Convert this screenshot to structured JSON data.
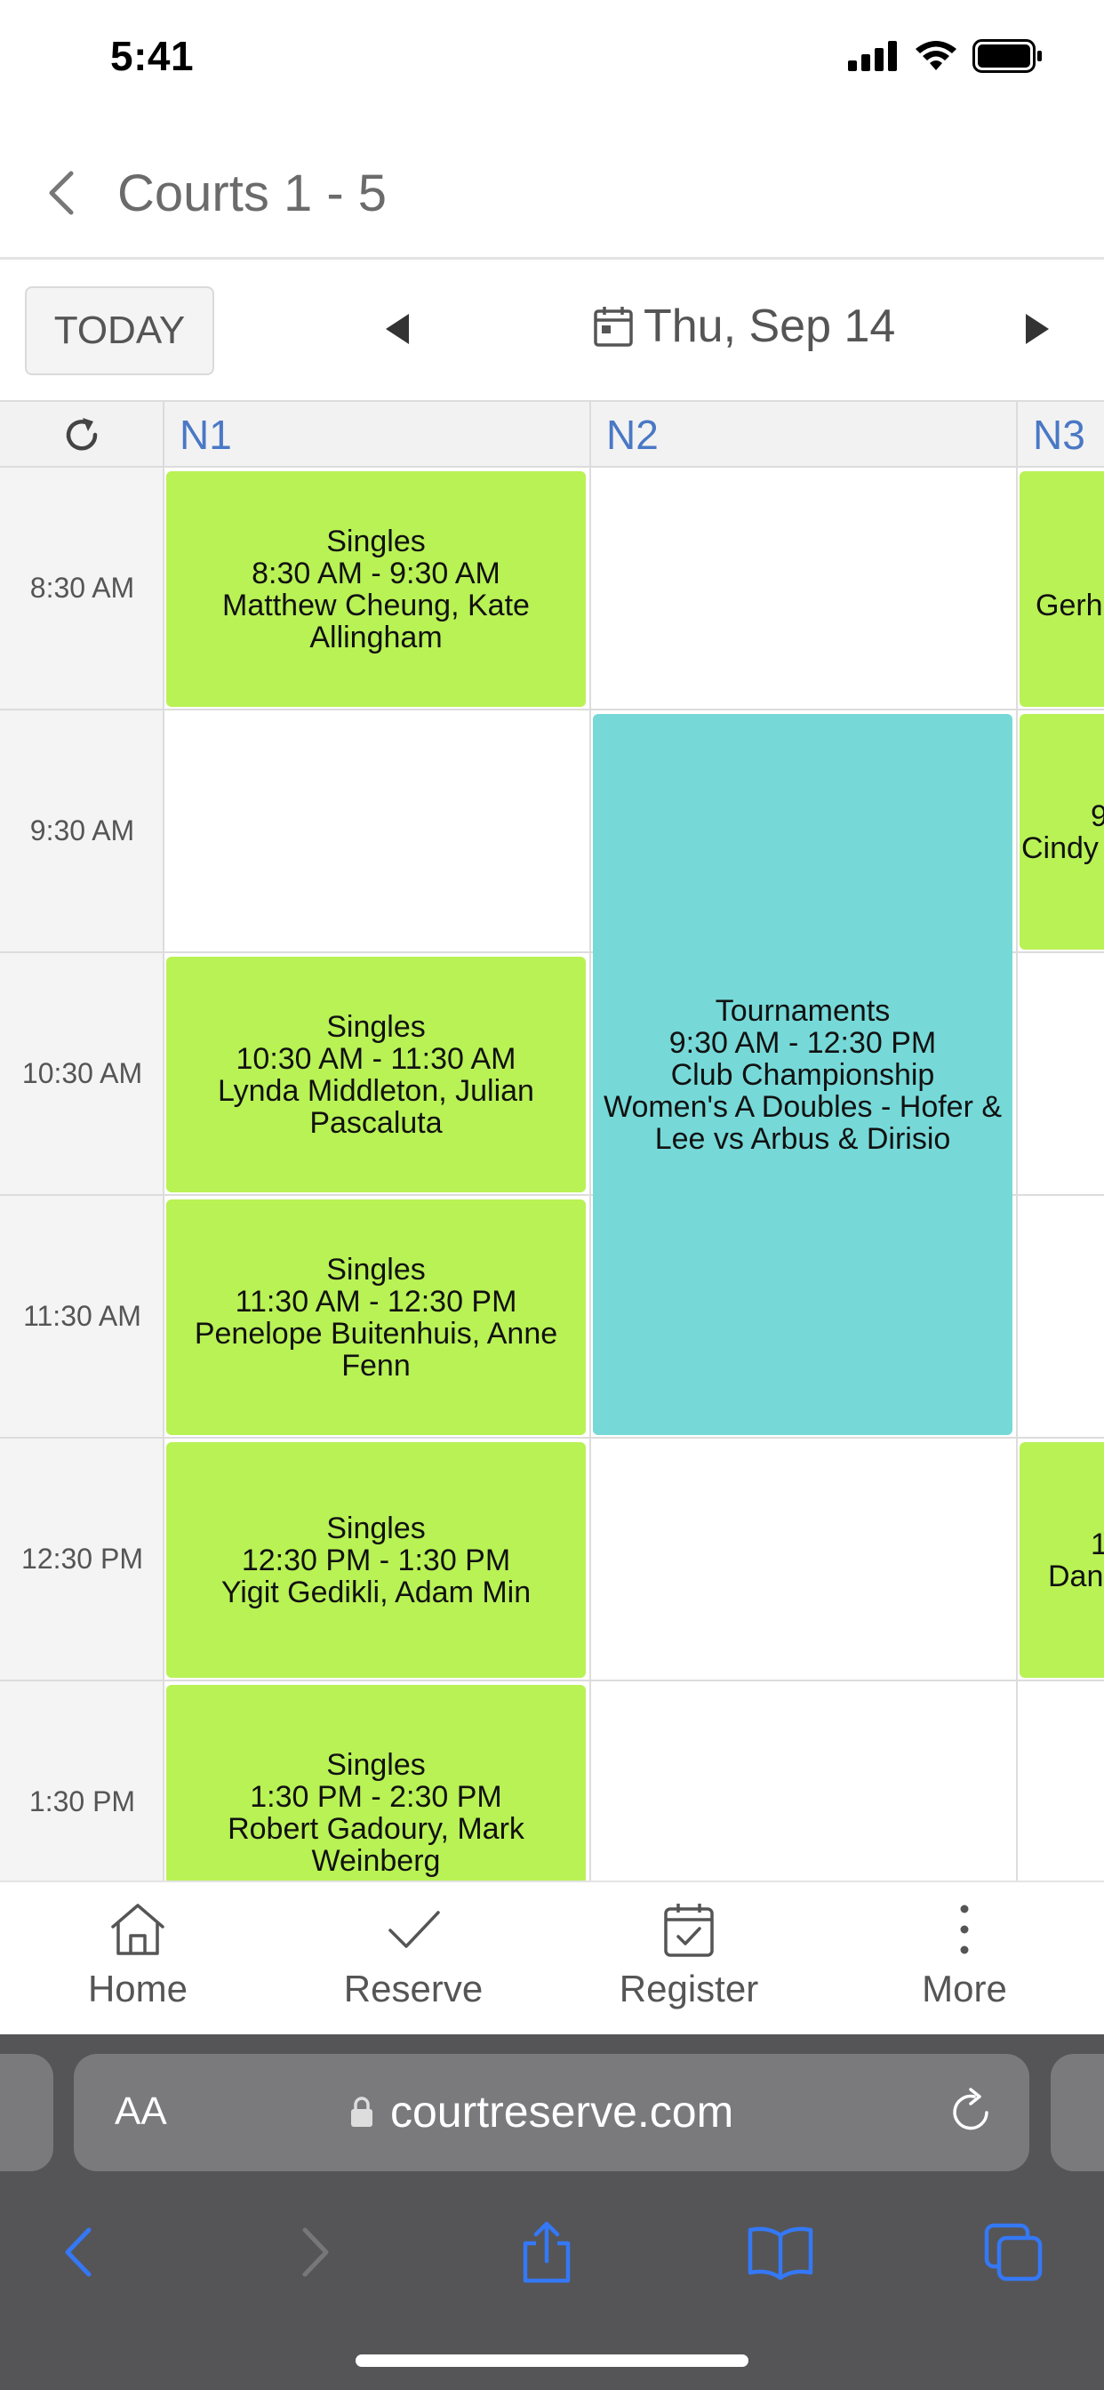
{
  "status_bar": {
    "time": "5:41"
  },
  "header": {
    "title": "Courts 1 - 5"
  },
  "toolbar": {
    "today_label": "TODAY",
    "date": "Thu, Sep 14"
  },
  "scheduler": {
    "courts": [
      "N1",
      "N2",
      "N3"
    ],
    "times": [
      "8:30 AM",
      "9:30 AM",
      "10:30 AM",
      "11:30 AM",
      "12:30 PM",
      "1:30 PM"
    ],
    "events": [
      {
        "court": "N1",
        "type": "Singles",
        "time": "8:30 AM - 9:30 AM",
        "players": "Matthew Cheung, Kate Allingham"
      },
      {
        "court": "N1",
        "type": "Singles",
        "time": "10:30 AM - 11:30 AM",
        "players": "Lynda Middleton, Julian Pascaluta"
      },
      {
        "court": "N1",
        "type": "Singles",
        "time": "11:30 AM - 12:30 PM",
        "players": "Penelope Buitenhuis, Anne Fenn"
      },
      {
        "court": "N1",
        "type": "Singles",
        "time": "12:30 PM - 1:30 PM",
        "players": "Yigit Gedikli, Adam Min"
      },
      {
        "court": "N1",
        "type": "Singles",
        "time": "1:30 PM - 2:30 PM",
        "players": "Robert Gadoury, Mark Weinberg"
      },
      {
        "court": "N2",
        "type": "Tournaments",
        "time": "9:30 AM - 12:30 PM",
        "title": "Club Championship",
        "detail": "Women's A Doubles - Hofer & Lee vs Arbus & Dirisio"
      },
      {
        "court": "N3",
        "partial_line1": "8",
        "partial_line2": "Gerh"
      },
      {
        "court": "N3",
        "partial_line1": "9",
        "partial_line2": "Cindy"
      },
      {
        "court": "N3",
        "partial_line1": "1",
        "partial_line2": "Dan"
      }
    ]
  },
  "tab_bar": {
    "items": [
      {
        "label": "Home",
        "icon": "home-icon"
      },
      {
        "label": "Reserve",
        "icon": "check-icon"
      },
      {
        "label": "Register",
        "icon": "calendar-check-icon"
      },
      {
        "label": "More",
        "icon": "more-vertical-icon"
      }
    ]
  },
  "browser": {
    "text_size_label": "AA",
    "url": "courtreserve.com"
  },
  "colors": {
    "singles": "#b8f255",
    "tournament": "#76d9d8",
    "court_header": "#4a78c5",
    "browser_blue": "#3478f6"
  }
}
